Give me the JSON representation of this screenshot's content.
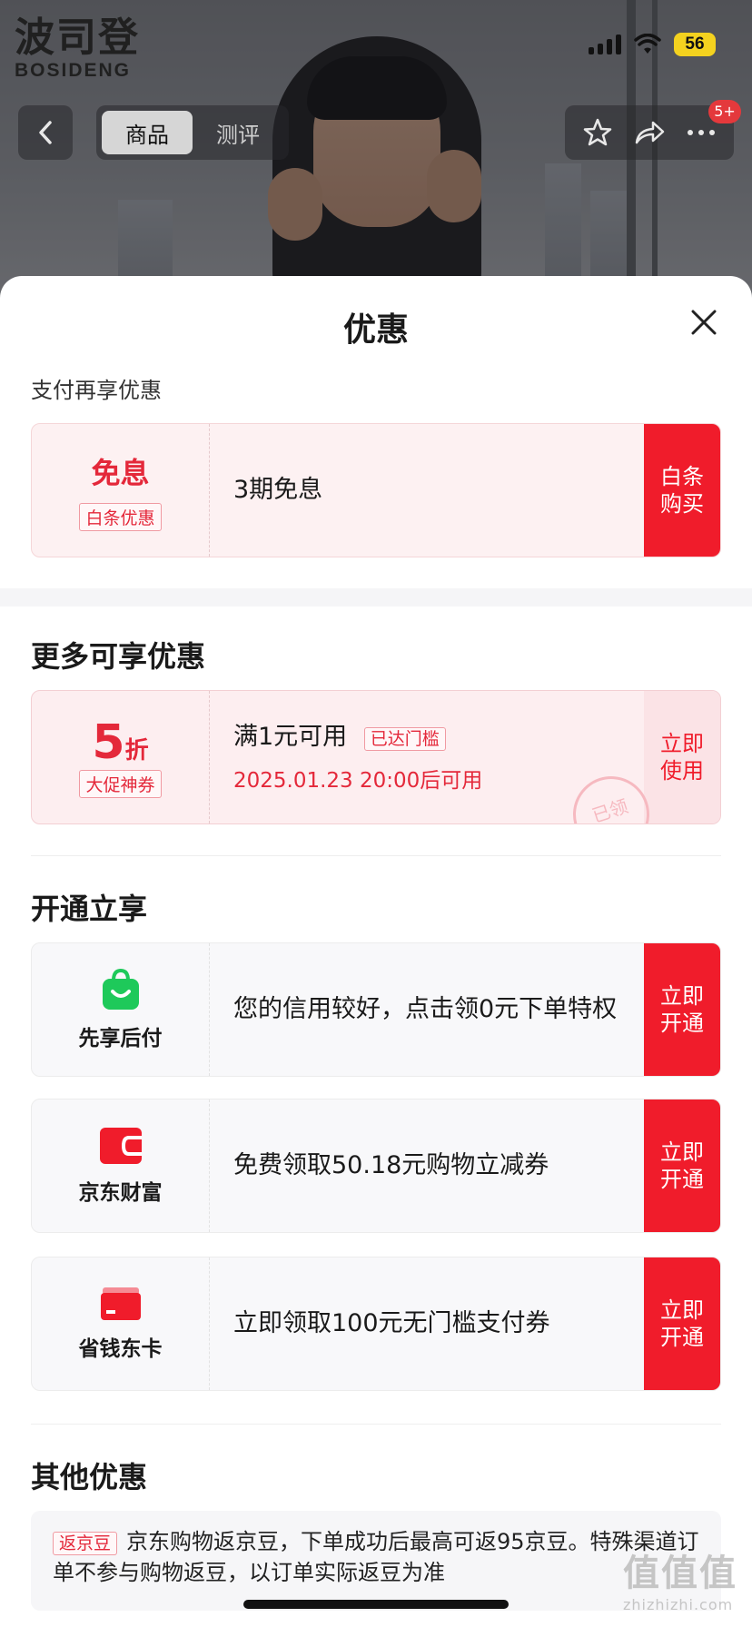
{
  "status_bar": {
    "battery": "56"
  },
  "brand": {
    "name_cn": "波司登",
    "name_en": "BOSIDENG"
  },
  "nav": {
    "tabs": [
      {
        "label": "商品"
      },
      {
        "label": "测评"
      }
    ],
    "badge": "5+"
  },
  "sheet": {
    "title": "优惠",
    "pay_section": {
      "label": "支付再享优惠",
      "card": {
        "title": "免息",
        "tag": "白条优惠",
        "text": "3期免息",
        "action": "白条购买"
      }
    },
    "more_section": {
      "title": "更多可享优惠",
      "card": {
        "discount_number": "5",
        "discount_unit": "折",
        "tag": "大促神券",
        "text": "满1元可用",
        "status_tag": "已达门槛",
        "time": "2025.01.23 20:00后可用",
        "stamp": "已领",
        "action": "立即使用"
      }
    },
    "open_section": {
      "title": "开通立享",
      "cards": [
        {
          "icon": "shopping-bag-icon",
          "icon_color": "#1ec95a",
          "name": "先享后付",
          "text": "您的信用较好，点击领0元下单特权",
          "action": "立即开通"
        },
        {
          "icon": "wallet-icon",
          "icon_color": "#f01c2b",
          "name": "京东财富",
          "text": "免费领取50.18元购物立减券",
          "action": "立即开通"
        },
        {
          "icon": "card-icon",
          "icon_color": "#f01c2b",
          "name": "省钱东卡",
          "text": "立即领取100元无门槛支付券",
          "action": "立即开通"
        }
      ]
    },
    "other_section": {
      "title": "其他优惠",
      "tag": "返京豆",
      "text": "京东购物返京豆，下单成功后最高可返95京豆。特殊渠道订单不参与购物返豆，以订单实际返豆为准"
    }
  },
  "watermark": {
    "text": "值值值",
    "sub": "zhizhizhi.com"
  },
  "colors": {
    "accent_red": "#f01c2b",
    "text_red": "#e4283a",
    "green": "#1ec95a"
  }
}
